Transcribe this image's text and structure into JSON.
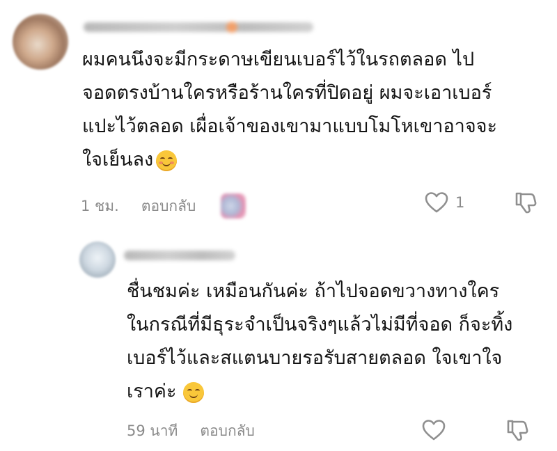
{
  "comments": [
    {
      "text_lines": [
        "ผมคนนึงจะมีกระดาษเขียนเบอร์ไว้ในรถตลอด ไป",
        "จอดตรงบ้านใครหรือร้านใครที่ปิดอยู่ ผมจะเอาเบอร์",
        "แปะไว้ตลอด เผื่อเจ้าของเขามาแบบโมโหเขาอาจจะ",
        "ใจเย็นลง"
      ],
      "emoji": "smiling-face-blush",
      "time": "1 ชม.",
      "reply_label": "ตอบกลับ",
      "like_count": "1"
    },
    {
      "text_lines": [
        "ชื่นชมค่ะ เหมือนกันค่ะ ถ้าไปจอดขวางทางใคร",
        "ในกรณีที่มีธุระจำเป็นจริงๆแล้วไม่มีที่จอด ก็จะทิ้ง",
        "เบอร์ไว้และสแตนบายรอรับสายตลอด ใจเขาใจ",
        "เราค่ะ"
      ],
      "emoji": "smiling-face",
      "time": "59 นาที",
      "reply_label": "ตอบกลับ"
    }
  ],
  "colors": {
    "text": "#141414",
    "meta": "#8a8a8a",
    "icon": "#8f8f8f",
    "emoji": "#f9c73a"
  },
  "icons": [
    "heart-icon",
    "dislike-icon"
  ]
}
